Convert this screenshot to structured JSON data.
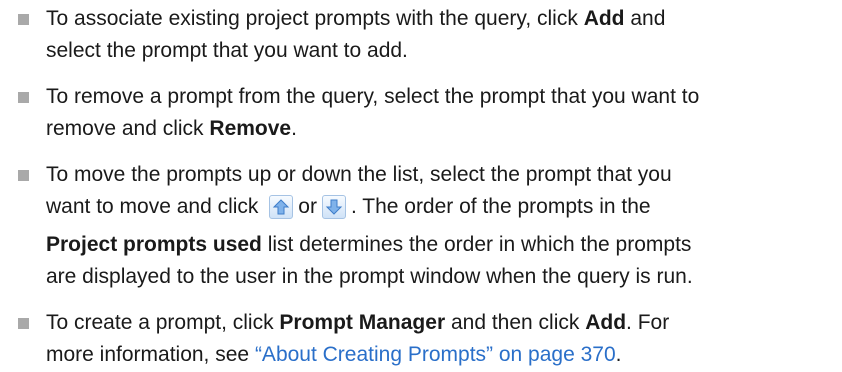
{
  "items": [
    {
      "line1": {
        "pre": "To associate existing project prompts with the query, click ",
        "bold": "Add",
        "post": " and"
      },
      "line2": "select the prompt that you want to add."
    },
    {
      "line1": "To remove a prompt from the query, select the prompt that you want to",
      "line2": {
        "pre": "remove and click ",
        "bold": "Remove",
        "post": "."
      }
    },
    {
      "line1": "To move the prompts up or down the list, select the prompt that you",
      "line2": {
        "pre": "want to move and click ",
        "mid": "or",
        "post": ". The order of the prompts in the"
      },
      "line3": {
        "bold": "Project prompts used",
        "post": " list determines the order in which the prompts"
      },
      "line4": "are displayed to the user in the prompt window when the query is run."
    },
    {
      "line1": {
        "pre": "To create a prompt, click ",
        "bold1": "Prompt Manager",
        "mid": " and then click ",
        "bold2": "Add",
        "post": ". For"
      },
      "line2": {
        "pre": "more information, see ",
        "link": "“About Creating Prompts” on page 370",
        "post": "."
      }
    }
  ],
  "icons": {
    "up": "move-up-arrow-icon",
    "down": "move-down-arrow-icon",
    "bullet": "square-bullet-icon"
  },
  "colors": {
    "bullet": "#a9a9a9",
    "link": "#2a6fc9",
    "text": "#1a1a1a"
  }
}
